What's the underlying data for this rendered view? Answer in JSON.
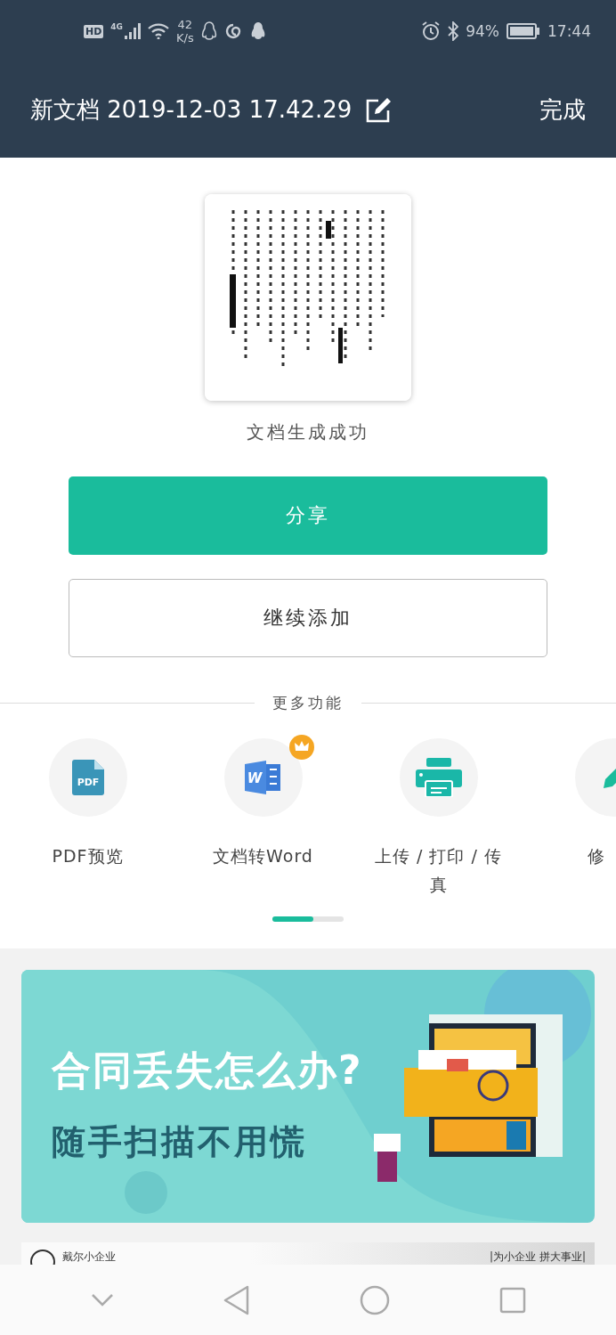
{
  "status_bar": {
    "hd": "HD",
    "network": "4G",
    "speed_value": "42",
    "speed_unit": "K/s",
    "battery": "94%",
    "time": "17:44"
  },
  "header": {
    "title": "新文档 2019-12-03 17.42.29",
    "done": "完成"
  },
  "document": {
    "caption": "文档生成成功"
  },
  "buttons": [
    {
      "label": "分享",
      "kind": "primary"
    },
    {
      "label": "继续添加",
      "kind": "outline"
    }
  ],
  "more": {
    "title": "更多功能",
    "items": [
      {
        "kind": "pdf",
        "icon_text": "PDF",
        "label": "PDF预览",
        "premium": false
      },
      {
        "kind": "word",
        "icon_text": "W",
        "label": "文档转Word",
        "premium": true
      },
      {
        "kind": "print",
        "label": "上传 / 打印 / 传真",
        "premium": false
      },
      {
        "kind": "edit",
        "label": "修",
        "premium": false
      }
    ]
  },
  "banner": {
    "headline": "合同丢失怎么办?",
    "subline": "随手扫描不用慌"
  },
  "next_ad": {
    "brand": "戴尔小企业",
    "slogan": "|为小企业 拼大事业|"
  }
}
